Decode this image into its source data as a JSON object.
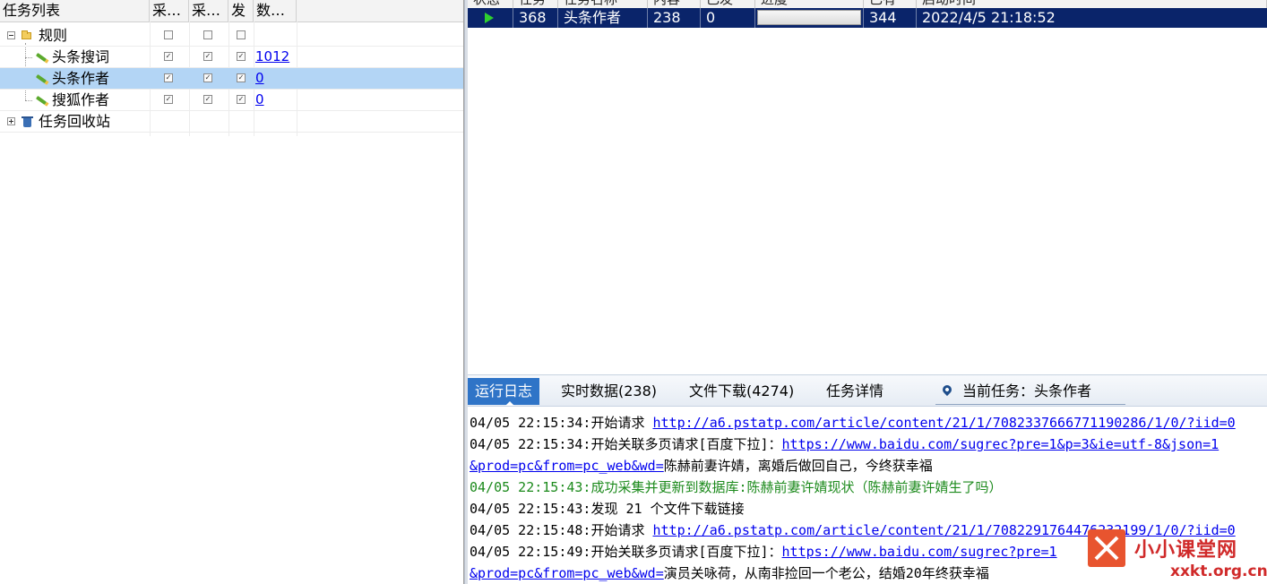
{
  "tree": {
    "headers": {
      "name": "任务列表",
      "col_collect1": "采…",
      "col_collect2": "采…",
      "col_publish": "发",
      "col_count": "数…"
    },
    "rows": [
      {
        "label": "规则",
        "checks": [
          false,
          false,
          false
        ],
        "count": ""
      },
      {
        "label": "头条搜词",
        "checks": [
          true,
          true,
          true
        ],
        "count": "1012"
      },
      {
        "label": "头条作者",
        "checks": [
          true,
          true,
          true
        ],
        "count": "0"
      },
      {
        "label": "搜狐作者",
        "checks": [
          true,
          true,
          true
        ],
        "count": "0"
      },
      {
        "label": "任务回收站"
      }
    ]
  },
  "tasks": {
    "headers": {
      "status": "状态",
      "task": "任务",
      "task_name": "任务名称",
      "content": "内容",
      "done": "已发",
      "progress": "进度",
      "existing": "已有",
      "start_time": "启动时间"
    },
    "row": {
      "id": "368",
      "name": "头条作者",
      "content": "238",
      "done": "0",
      "progress": 0,
      "existing": "344",
      "start_time": "2022/4/5 21:18:52"
    }
  },
  "bottom": {
    "tabs": [
      "运行日志",
      "实时数据(238)",
      "文件下载(4274)",
      "任务详情"
    ],
    "current_task": "当前任务：头条作者",
    "log": [
      {
        "text": "04/05 22:15:34:开始请求 ",
        "url": "http://a6.pstatp.com/article/content/21/1/7082337666771190286/1/0/?iid=0",
        "tail": ""
      },
      {
        "text": "04/05 22:15:34:开始关联多页请求[百度下拉]：",
        "url": "https://www.baidu.com/sugrec?pre=1&p=3&ie=utf-8&json=1",
        "tail": ""
      },
      {
        "text": "",
        "url": "&prod=pc&from=pc_web&wd=",
        "tail": "陈赫前妻许婧，离婚后做回自己，今终获幸福"
      },
      {
        "text": "04/05 22:15:43:成功采集并更新到数据库:陈赫前妻许婧现状（陈赫前妻许婧生了吗）",
        "url": "",
        "tail": "",
        "green": true
      },
      {
        "text": "04/05 22:15:43:发现 21 个文件下载链接",
        "url": "",
        "tail": ""
      },
      {
        "text": "04/05 22:15:48:开始请求 ",
        "url": "http://a6.pstatp.com/article/content/21/1/7082291764476232199/1/0/?iid=0",
        "tail": ""
      },
      {
        "text": "04/05 22:15:49:开始关联多页请求[百度下拉]：",
        "url": "https://www.baidu.com/sugrec?pre=1",
        "tail": ""
      },
      {
        "text": "",
        "url": "&prod=pc&from=pc_web&wd=",
        "tail": "演员关咏荷，从南非捡回一个老公，结婚20年终获幸福"
      }
    ]
  },
  "watermark": {
    "name": "小小课堂网",
    "domain": "xxkt.org.cn"
  },
  "colors": {
    "selected_row": "#0a246a",
    "tree_selected": "#b3d5f5",
    "active_tab": "#2f74c7",
    "log_success": "#1c8a1c",
    "link": "#0000ee"
  }
}
